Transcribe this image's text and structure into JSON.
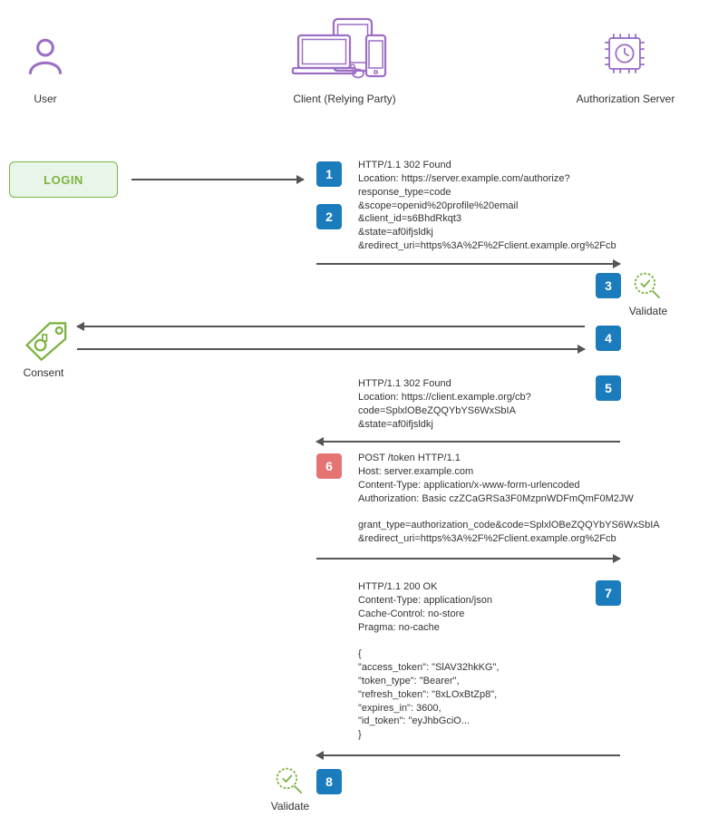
{
  "actors": {
    "user": "User",
    "client": "Client (Relying Party)",
    "server": "Authorization Server"
  },
  "login_label": "LOGIN",
  "consent_label": "Consent",
  "validate1_label": "Validate",
  "validate2_label": "Validate",
  "steps": {
    "s1": "1",
    "s2": "2",
    "s3": "3",
    "s4": "4",
    "s5": "5",
    "s6": "6",
    "s7": "7",
    "s8": "8"
  },
  "http": {
    "block1": "HTTP/1.1 302 Found\nLocation: https://server.example.com/authorize?\nresponse_type=code\n&scope=openid%20profile%20email\n&client_id=s6BhdRkqt3\n&state=af0ifjsldkj\n&redirect_uri=https%3A%2F%2Fclient.example.org%2Fcb",
    "block2": "HTTP/1.1 302 Found\nLocation: https://client.example.org/cb?\ncode=SplxlOBeZQQYbYS6WxSbIA\n&state=af0ifjsldkj",
    "block3": "POST /token HTTP/1.1\nHost: server.example.com\nContent-Type: application/x-www-form-urlencoded\nAuthorization: Basic czZCaGRSa3F0MzpnWDFmQmF0M2JW\n\ngrant_type=authorization_code&code=SplxlOBeZQQYbYS6WxSbIA\n&redirect_uri=https%3A%2F%2Fclient.example.org%2Fcb",
    "block4": "HTTP/1.1 200 OK\nContent-Type: application/json\nCache-Control: no-store\nPragma: no-cache\n\n{\n\"access_token\": \"SlAV32hkKG\",\n\"token_type\": \"Bearer\",\n\"refresh_token\": \"8xLOxBtZp8\",\n\"expires_in\": 3600,\n\"id_token\": \"eyJhbGciO...\n}"
  }
}
